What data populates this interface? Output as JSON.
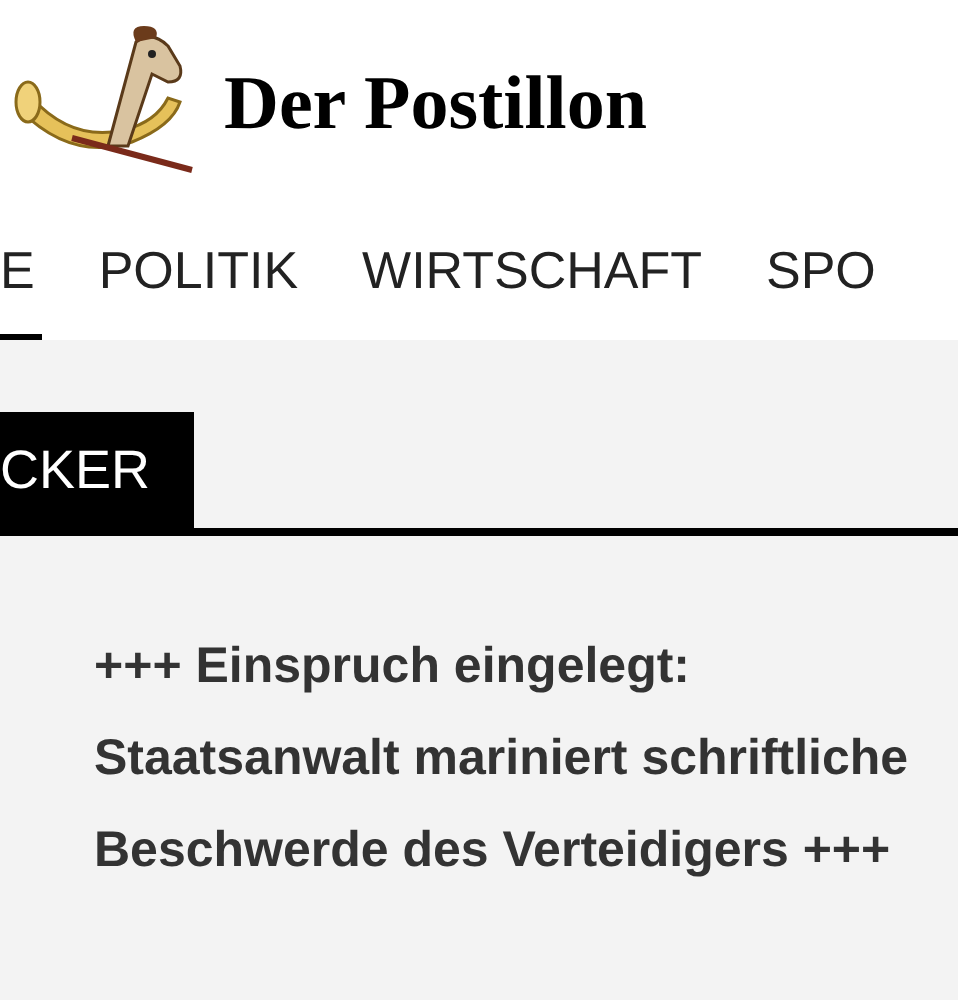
{
  "logo": {
    "title": "Der Postillon"
  },
  "nav": [
    {
      "label": "E",
      "selected": true
    },
    {
      "label": "POLITIK",
      "selected": false
    },
    {
      "label": "WIRTSCHAFT",
      "selected": false
    },
    {
      "label": "SPO",
      "selected": false
    }
  ],
  "section_tag": "CKER",
  "article": {
    "title": "+++ Einspruch eingelegt: Staatsanwalt mariniert schriftliche Beschwerde des Verteidigers +++"
  }
}
